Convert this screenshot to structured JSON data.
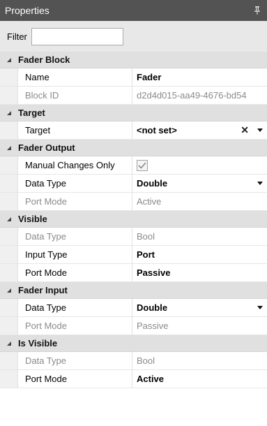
{
  "title": "Properties",
  "filter": {
    "label": "Filter",
    "value": ""
  },
  "categories": {
    "fader_block": {
      "label": "Fader Block",
      "rows": {
        "name": {
          "label": "Name",
          "value": "Fader"
        },
        "block_id": {
          "label": "Block ID",
          "value": "d2d4d015-aa49-4676-bd54"
        }
      }
    },
    "target": {
      "label": "Target",
      "rows": {
        "target": {
          "label": "Target",
          "value": "<not set>"
        }
      }
    },
    "fader_output": {
      "label": "Fader Output",
      "rows": {
        "manual_changes_only": {
          "label": "Manual Changes Only",
          "checked": true
        },
        "data_type": {
          "label": "Data Type",
          "value": "Double"
        },
        "port_mode": {
          "label": "Port Mode",
          "value": "Active"
        }
      }
    },
    "visible": {
      "label": "Visible",
      "rows": {
        "data_type": {
          "label": "Data Type",
          "value": "Bool"
        },
        "input_type": {
          "label": "Input Type",
          "value": "Port"
        },
        "port_mode": {
          "label": "Port Mode",
          "value": "Passive"
        }
      }
    },
    "fader_input": {
      "label": "Fader Input",
      "rows": {
        "data_type": {
          "label": "Data Type",
          "value": "Double"
        },
        "port_mode": {
          "label": "Port Mode",
          "value": "Passive"
        }
      }
    },
    "is_visible": {
      "label": "Is Visible",
      "rows": {
        "data_type": {
          "label": "Data Type",
          "value": "Bool"
        },
        "port_mode": {
          "label": "Port Mode",
          "value": "Active"
        }
      }
    }
  }
}
